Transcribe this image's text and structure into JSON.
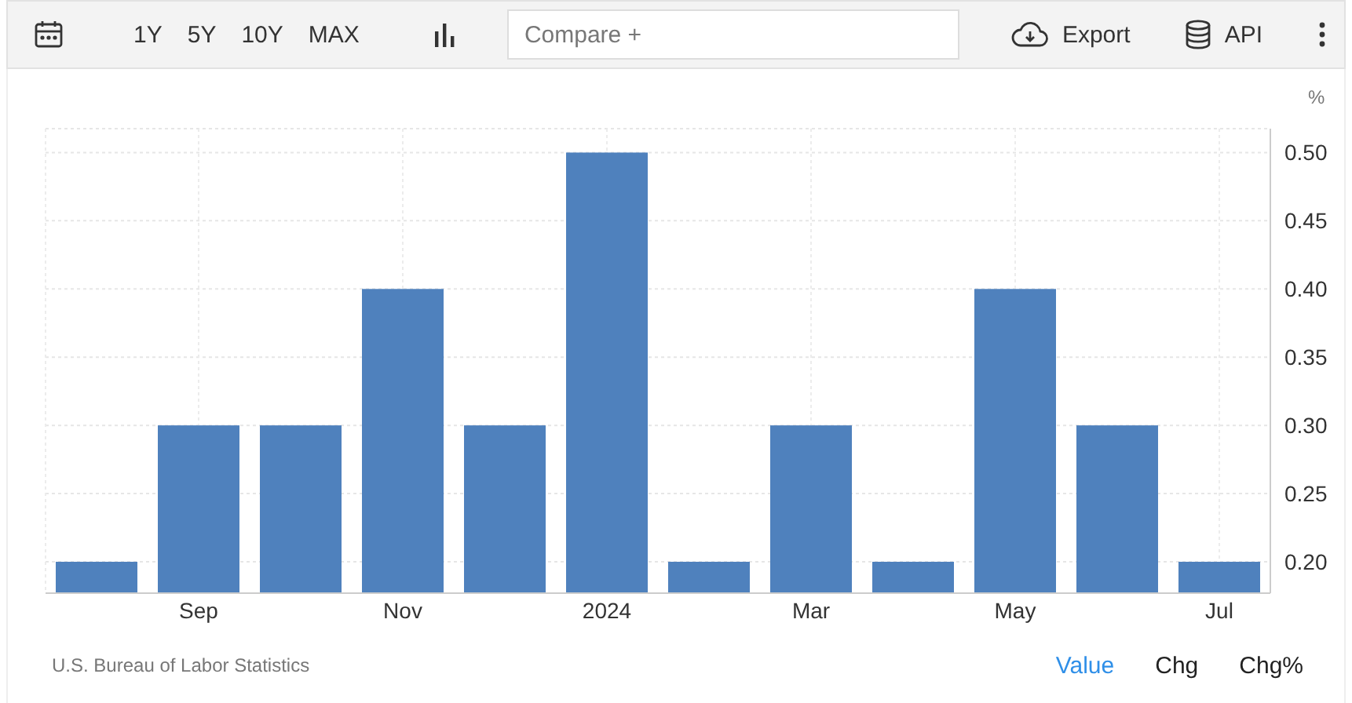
{
  "toolbar": {
    "ranges": [
      {
        "label": "1Y",
        "selected": false
      },
      {
        "label": "5Y",
        "selected": false
      },
      {
        "label": "10Y",
        "selected": false
      },
      {
        "label": "MAX",
        "selected": false
      }
    ],
    "compare": {
      "placeholder": "Compare +"
    },
    "export": "Export",
    "api": "API"
  },
  "chart": {
    "unit": "%",
    "chart_data": {
      "type": "bar",
      "values": [
        0.2,
        0.3,
        0.3,
        0.4,
        0.3,
        0.5,
        0.2,
        0.3,
        0.2,
        0.4,
        0.3,
        0.2
      ],
      "categories": [
        null,
        "Sep",
        null,
        "Nov",
        null,
        "2024",
        null,
        "Mar",
        null,
        "May",
        null,
        "Jul"
      ],
      "grid": true,
      "ylim": [
        0.177,
        0.5175
      ],
      "yticks": [
        {
          "value": 0.2,
          "label": "0.20"
        },
        {
          "value": 0.25,
          "label": "0.25"
        },
        {
          "value": 0.3,
          "label": "0.30"
        },
        {
          "value": 0.35,
          "label": "0.35"
        },
        {
          "value": 0.4,
          "label": "0.40"
        },
        {
          "value": 0.45,
          "label": "0.45"
        },
        {
          "value": 0.5,
          "label": "0.50"
        }
      ]
    }
  },
  "footer": {
    "source": "U.S. Bureau of Labor Statistics",
    "modes": [
      {
        "label": "Value",
        "selected": true
      },
      {
        "label": "Chg",
        "selected": false
      },
      {
        "label": "Chg%",
        "selected": false
      }
    ]
  }
}
